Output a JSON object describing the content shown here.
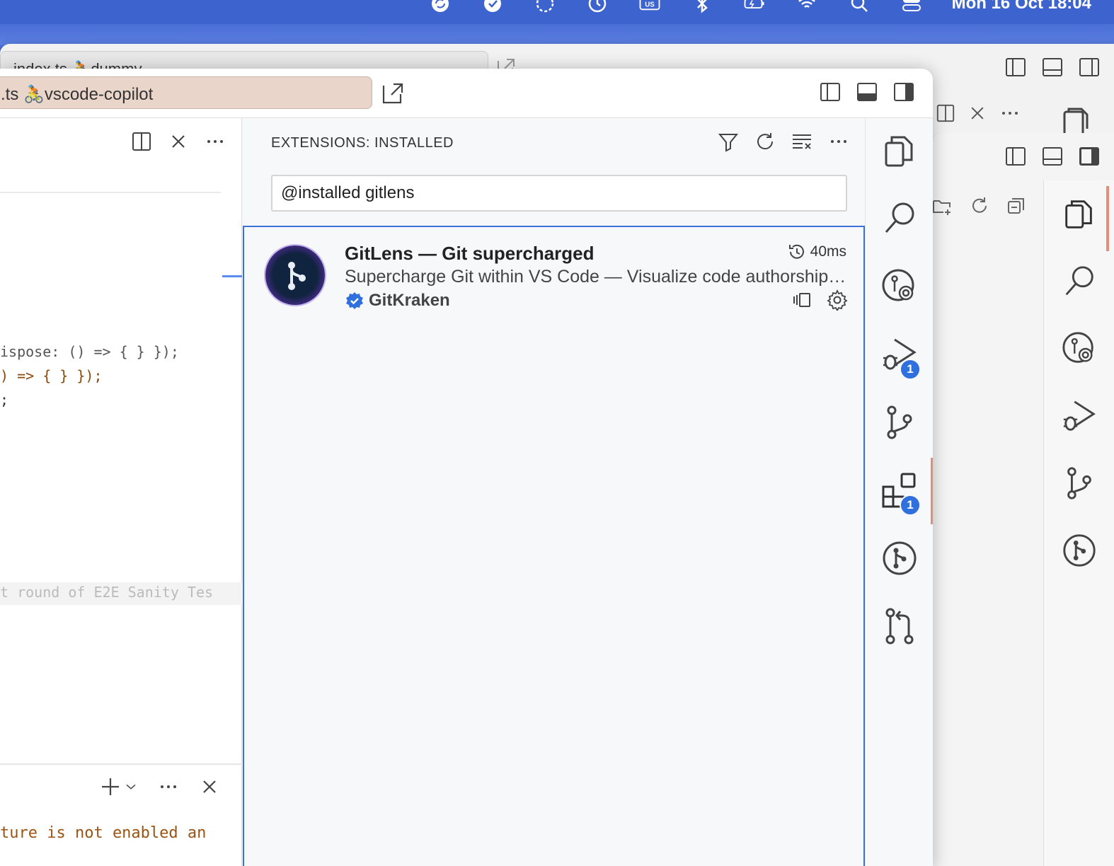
{
  "menubar": {
    "icons": [
      "sync-icon",
      "shield-check-icon",
      "clock-dashed-icon",
      "timer-icon",
      "keyboard-layout-icon",
      "bluetooth-icon",
      "battery-icon",
      "wifi-icon",
      "spotlight-icon",
      "control-center-icon"
    ],
    "keyboard_layout": "US",
    "clock": "Mon 16 Oct  18:04"
  },
  "back_window": {
    "title_search": "index.ts 🚴dummy"
  },
  "front_window": {
    "title_search": ".ts 🚴vscode-copilot"
  },
  "editor": {
    "code_lines": [
      "ispose: () => { } });",
      ") => { } });",
      ";"
    ],
    "ghost_text": "t round of E2E Sanity Tes",
    "terminal_output": "ture is not enabled an"
  },
  "sidebar": {
    "title": "EXTENSIONS: INSTALLED",
    "search_value": "@installed gitlens",
    "extensions": [
      {
        "name": "GitLens — Git supercharged",
        "description": "Supercharge Git within VS Code — Visualize code authorship at a glance via Git blame annotations",
        "publisher": "GitKraken",
        "activation_time": "40ms",
        "verified": true
      }
    ]
  },
  "activity_bar": {
    "items": [
      {
        "name": "explorer",
        "badge": null
      },
      {
        "name": "search",
        "badge": null
      },
      {
        "name": "gitlens-inspect",
        "badge": null
      },
      {
        "name": "run-and-debug",
        "badge": "1"
      },
      {
        "name": "source-control",
        "badge": null
      },
      {
        "name": "extensions",
        "badge": "1",
        "active": true
      },
      {
        "name": "gitlens",
        "badge": null
      },
      {
        "name": "pull-requests",
        "badge": null
      }
    ]
  },
  "colors": {
    "menubar": "#3d63cf",
    "accent": "#2f6fde",
    "active_indicator": "#e58c7a",
    "title_search_bg": "#e9d5c9"
  }
}
